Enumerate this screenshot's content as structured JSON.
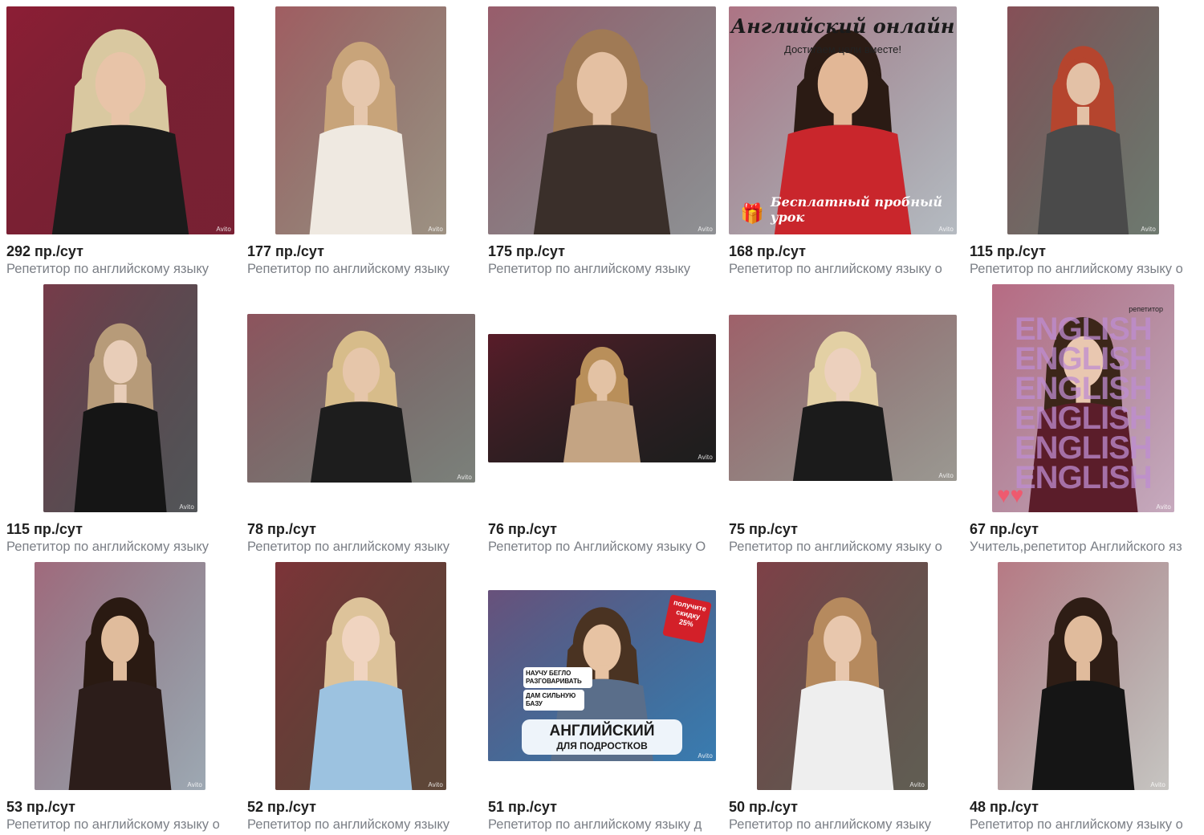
{
  "watermark": "Avito",
  "items": [
    {
      "views": "292 пр./сут",
      "desc": "Репетитор по английскому языку",
      "bg": "#8c1e35",
      "fg": "#1b1b1b",
      "skin": "#e8c4a8",
      "hair": "#d9c8a0"
    },
    {
      "views": "177 пр./сут",
      "desc": "Репетитор по английскому языку",
      "bg": "#b9aa98",
      "fg": "#efe9e1",
      "skin": "#e6c7ad",
      "hair": "#c8a47a"
    },
    {
      "views": "175 пр./сут",
      "desc": "Репетитор по английскому языку",
      "bg": "#a7a9ad",
      "fg": "#3a2f2a",
      "skin": "#e4c0a2",
      "hair": "#a07a55"
    },
    {
      "views": "168 пр./сут",
      "desc": "Репетитор по английскому языку о",
      "bg": "#d6dde5",
      "fg": "#c9262c",
      "skin": "#e2b796",
      "hair": "#2b1b14",
      "banner": {
        "title": "Английский онлайн",
        "subtitle": "Достигаем цели вместе!",
        "footer": "Бесплатный пробный урок"
      }
    },
    {
      "views": "115 пр./сут",
      "desc": "Репетитор по английскому языку о",
      "bg": "#7f8c80",
      "fg": "#4a4a4a",
      "skin": "#e3c1a6",
      "hair": "#b5452e"
    },
    {
      "views": "115 пр./сут",
      "desc": "Репетитор по английскому языку",
      "bg": "#5c5f63",
      "fg": "#151515",
      "skin": "#e8cdb8",
      "hair": "#b79b79"
    },
    {
      "views": "78 пр./сут",
      "desc": "Репетитор по английскому языку",
      "bg": "#8f958e",
      "fg": "#1d1d1d",
      "skin": "#e6c6aa",
      "hair": "#d7bc8a"
    },
    {
      "views": "76 пр./сут",
      "desc": "Репетитор по Английскому языку О",
      "bg": "#1a1a1a",
      "fg": "#c4a483",
      "skin": "#e3c2a4",
      "hair": "#b98f5a"
    },
    {
      "views": "75 пр./сут",
      "desc": "Репетитор по английскому языку о",
      "bg": "#b6b2aa",
      "fg": "#1b1b1b",
      "skin": "#ecd0bd",
      "hair": "#e3d0a4"
    },
    {
      "views": "67 пр./сут",
      "desc": "Учитель,репетитор Английского яз",
      "bg": "#ecc8e1",
      "fg": "#5b1d2a",
      "skin": "#e9c7b0",
      "hair": "#3c2619",
      "banner": {
        "word": "ENGLISH",
        "tag": "репетитор"
      }
    },
    {
      "views": "53 пр./сут",
      "desc": "Репетитор по английскому языку о",
      "bg": "#b9c6d3",
      "fg": "#2c1d1a",
      "skin": "#e0bc9c",
      "hair": "#2a1a12"
    },
    {
      "views": "52 пр./сут",
      "desc": "Репетитор по английскому языку",
      "bg": "#6a4e3b",
      "fg": "#9cc2e0",
      "skin": "#f0d4c0",
      "hair": "#ddc39a"
    },
    {
      "views": "51 пр./сут",
      "desc": "Репетитор по английскому языку д",
      "bg": "#3d8fd0",
      "fg": "#5a6e8a",
      "skin": "#e7c3a3",
      "hair": "#4a3322",
      "banner": {
        "badge": "получите скидку 25%",
        "line1": "НАУЧУ БЕГЛО РАЗГОВАРИВАТЬ",
        "line2": "ДАМ СИЛЬНУЮ БАЗУ",
        "title": "АНГЛИЙСКИЙ",
        "subtitle": "ДЛЯ ПОДРОСТКОВ"
      }
    },
    {
      "views": "50 пр./сут",
      "desc": "Репетитор по английскому языку",
      "bg": "#6e6a5d",
      "fg": "#eeeeee",
      "skin": "#e8c7ad",
      "hair": "#b68a5e"
    },
    {
      "views": "48 пр./сут",
      "desc": "Репетитор по английскому языку о",
      "bg": "#ece9e5",
      "fg": "#151515",
      "skin": "#e0bb9c",
      "hair": "#2e1d15"
    }
  ]
}
